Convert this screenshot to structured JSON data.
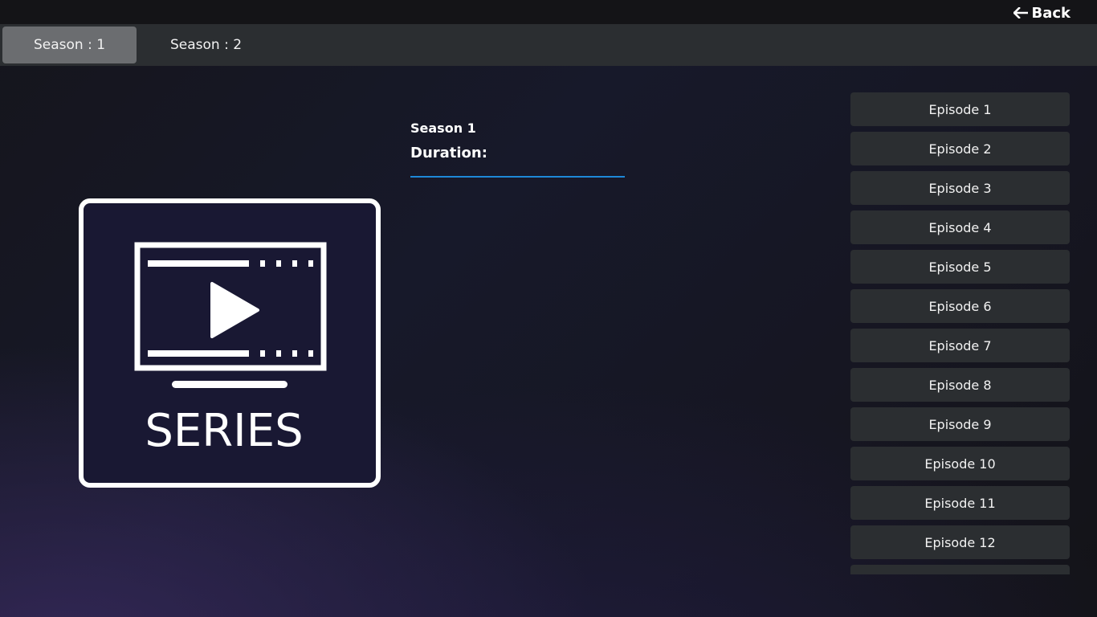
{
  "header": {
    "back_label": "Back",
    "back_icon": "arrow-left-icon"
  },
  "seasons": {
    "tabs": [
      {
        "label": "Season : 1",
        "active": true
      },
      {
        "label": "Season : 2",
        "active": false
      }
    ]
  },
  "poster": {
    "icon": "tv-play-icon",
    "text": "SERIES"
  },
  "info": {
    "season_title": "Season 1",
    "duration_label": "Duration:",
    "accent_color": "#1e88d8"
  },
  "episodes": [
    {
      "label": "Episode 1"
    },
    {
      "label": "Episode 2"
    },
    {
      "label": "Episode 3"
    },
    {
      "label": "Episode 4"
    },
    {
      "label": "Episode 5"
    },
    {
      "label": "Episode 6"
    },
    {
      "label": "Episode 7"
    },
    {
      "label": "Episode 8"
    },
    {
      "label": "Episode 9"
    },
    {
      "label": "Episode 10"
    },
    {
      "label": "Episode 11"
    },
    {
      "label": "Episode 12"
    },
    {
      "label": ""
    }
  ]
}
